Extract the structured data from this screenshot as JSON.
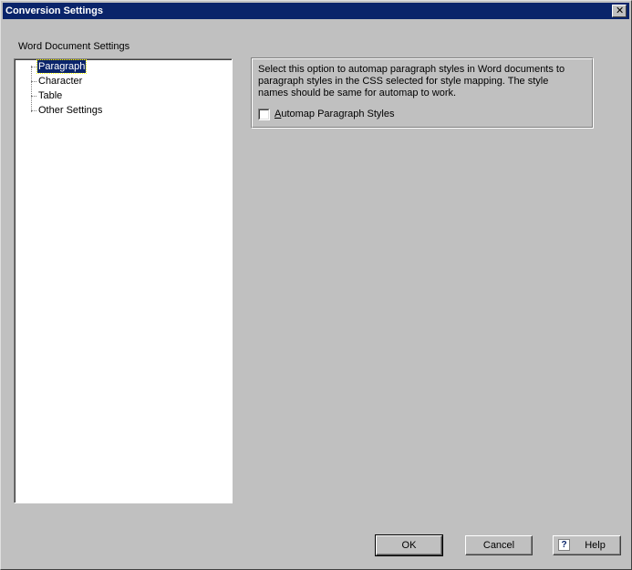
{
  "window": {
    "title": "Conversion Settings",
    "close_glyph": "✕"
  },
  "tree": {
    "group_label": "Word Document Settings",
    "items": [
      {
        "label": "Paragraph",
        "selected": true
      },
      {
        "label": "Character",
        "selected": false
      },
      {
        "label": "Table",
        "selected": false
      },
      {
        "label": "Other Settings",
        "selected": false
      }
    ]
  },
  "paragraph_panel": {
    "description": "Select this option to automap paragraph styles in Word documents to paragraph styles in the CSS selected for style mapping. The style names should be same for automap to work.",
    "checkbox_label": "Automap Paragraph Styles",
    "checkbox_checked": false
  },
  "buttons": {
    "ok": "OK",
    "cancel": "Cancel",
    "help": "Help",
    "help_icon_glyph": "?"
  },
  "colors": {
    "titlebar": "#0a246a",
    "face": "#c0c0c0",
    "selection": "#0a246a"
  }
}
